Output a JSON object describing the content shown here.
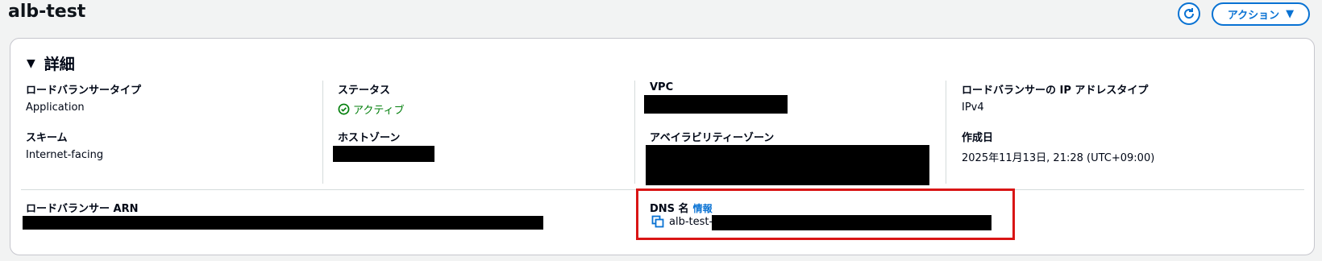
{
  "header": {
    "title": "alb-test",
    "actions_label": "アクション",
    "actions_caret": "▼"
  },
  "panel": {
    "title": "詳細",
    "caret": "▼",
    "fields": {
      "lb_type": {
        "label": "ロードバランサータイプ",
        "value": "Application"
      },
      "scheme": {
        "label": "スキーム",
        "value": "Internet-facing"
      },
      "status": {
        "label": "ステータス",
        "value": "アクティブ"
      },
      "hosted_zone": {
        "label": "ホストゾーン"
      },
      "vpc": {
        "label": "VPC"
      },
      "az": {
        "label": "アベイラビリティーゾーン"
      },
      "ip_type": {
        "label": "ロードバランサーの IP アドレスタイプ",
        "value": "IPv4"
      },
      "created": {
        "label": "作成日",
        "value": "2025年11月13日, 21:28 (UTC+09:00)"
      },
      "arn": {
        "label": "ロードバランサー ARN"
      },
      "dns": {
        "label": "DNS 名",
        "info": "情報",
        "value_prefix": "alb-test-"
      }
    }
  },
  "colors": {
    "accent": "#0972d3",
    "success": "#037f0c",
    "highlight": "#d91515"
  }
}
